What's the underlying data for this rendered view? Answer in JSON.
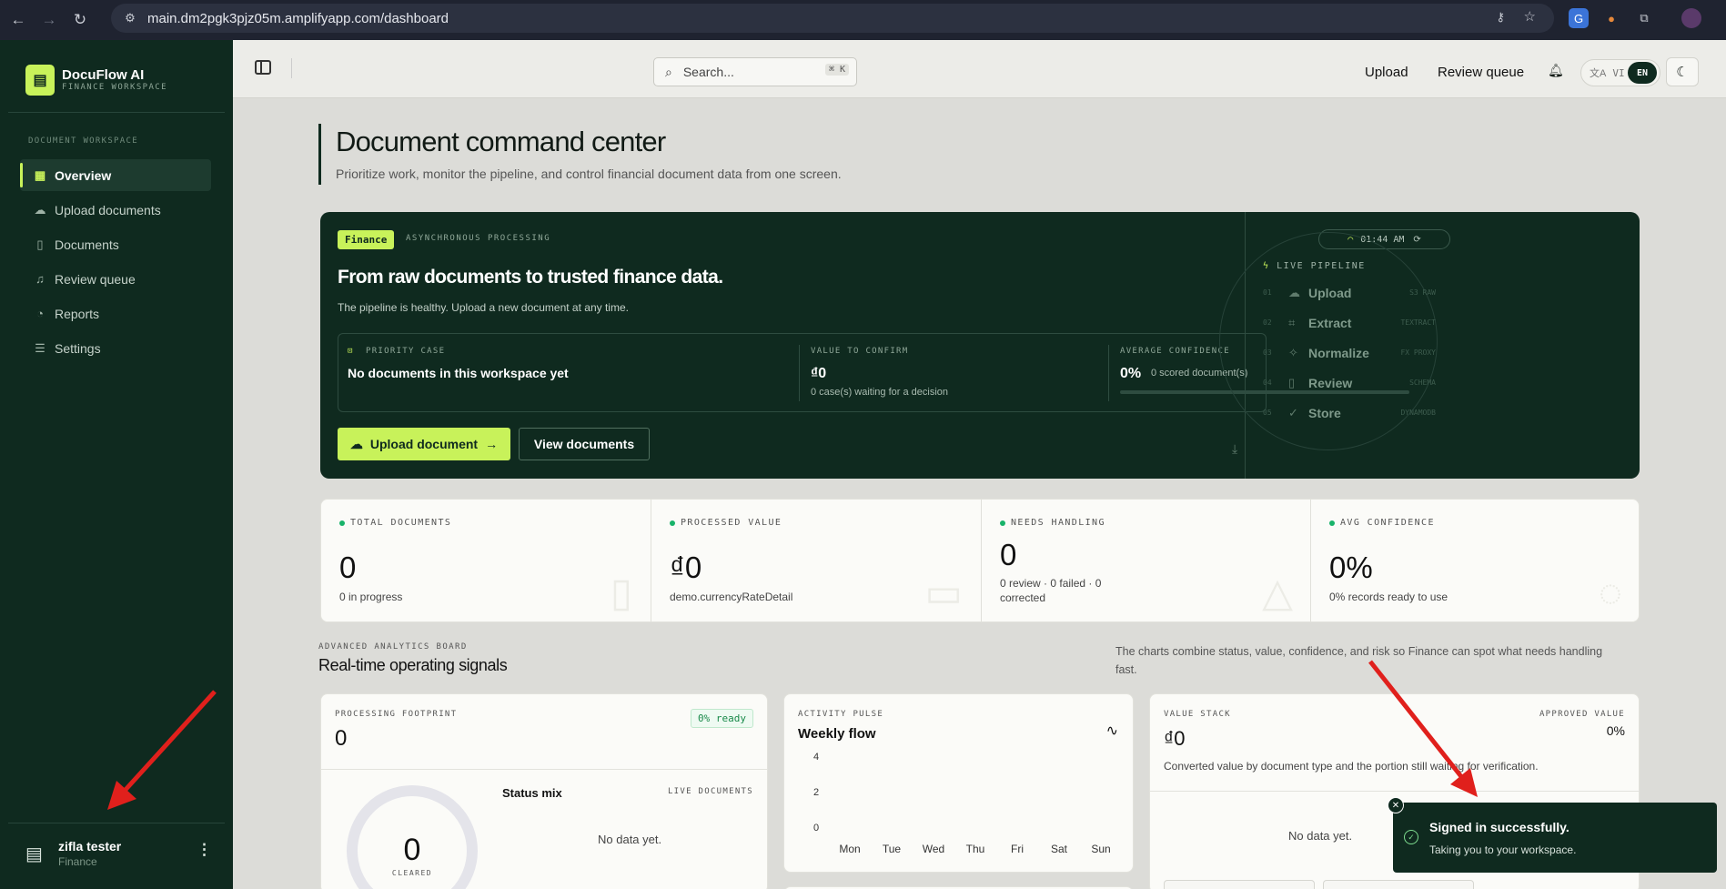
{
  "browser": {
    "url": "main.dm2pgk3pjz05m.amplifyapp.com/dashboard"
  },
  "sidebar": {
    "brand": "DocuFlow AI",
    "brand_sub": "FINANCE WORKSPACE",
    "section_label": "DOCUMENT WORKSPACE",
    "items": [
      {
        "label": "Overview",
        "icon": "grid-icon",
        "active": true
      },
      {
        "label": "Upload documents",
        "icon": "cloud-upload-icon"
      },
      {
        "label": "Documents",
        "icon": "file-icon"
      },
      {
        "label": "Review queue",
        "icon": "bell-icon"
      },
      {
        "label": "Reports",
        "icon": "chart-icon"
      },
      {
        "label": "Settings",
        "icon": "sliders-icon"
      }
    ],
    "user": {
      "name": "zifla tester",
      "role": "Finance"
    }
  },
  "topbar": {
    "search_placeholder": "Search...",
    "search_shortcut": "⌘ K",
    "upload_label": "Upload",
    "review_label": "Review queue",
    "lang_vi": "VI",
    "lang_en": "EN"
  },
  "header": {
    "title": "Document command center",
    "subtitle": "Prioritize work, monitor the pipeline, and control financial document data from one screen."
  },
  "hero": {
    "badge": "Finance",
    "mode": "ASYNCHRONOUS PROCESSING",
    "time": "01:44 AM",
    "title": "From raw documents to trusted finance data.",
    "subtitle": "The pipeline is healthy. Upload a new document at any time.",
    "priority_label": "PRIORITY CASE",
    "priority_value": "No documents in this workspace yet",
    "confirm_label": "VALUE TO CONFIRM",
    "confirm_value": "₫0",
    "confirm_sub": "0 case(s) waiting for a decision",
    "confidence_label": "AVERAGE CONFIDENCE",
    "confidence_value": "0%",
    "confidence_sub": "0 scored document(s)",
    "confidence_fraction": 0,
    "upload_btn": "Upload document",
    "view_btn": "View documents",
    "pipeline_label": "LIVE PIPELINE",
    "pipeline": [
      {
        "num": "01",
        "name": "Upload",
        "tag": "S3 RAW"
      },
      {
        "num": "02",
        "name": "Extract",
        "tag": "TEXTRACT"
      },
      {
        "num": "03",
        "name": "Normalize",
        "tag": "FX PROXY"
      },
      {
        "num": "04",
        "name": "Review",
        "tag": "SCHEMA"
      },
      {
        "num": "05",
        "name": "Store",
        "tag": "DYNAMODB"
      }
    ]
  },
  "stats": [
    {
      "label": "TOTAL DOCUMENTS",
      "value": "0",
      "sub": "0 in progress"
    },
    {
      "label": "PROCESSED VALUE",
      "value": "₫0",
      "sub": "demo.currencyRateDetail"
    },
    {
      "label": "NEEDS HANDLING",
      "value": "0",
      "sub": "0 review · 0 failed · 0 corrected"
    },
    {
      "label": "AVG CONFIDENCE",
      "value": "0%",
      "sub": "0% records ready to use"
    }
  ],
  "analytics": {
    "label": "ADVANCED ANALYTICS BOARD",
    "title": "Real-time operating signals",
    "desc": "The charts combine status, value, confidence, and risk so Finance can spot what needs handling fast."
  },
  "footprint": {
    "label": "PROCESSING FOOTPRINT",
    "value": "0",
    "ready": "0% ready",
    "donut_value": "0",
    "donut_label": "CLEARED",
    "mix_title": "Status mix",
    "live_label": "LIVE DOCUMENTS",
    "empty": "No data yet."
  },
  "pulse": {
    "label": "ACTIVITY PULSE",
    "title": "Weekly flow",
    "y_ticks": [
      "4",
      "2",
      "0"
    ],
    "days": [
      "Mon",
      "Tue",
      "Wed",
      "Thu",
      "Fri",
      "Sat",
      "Sun"
    ]
  },
  "value_stack": {
    "label": "VALUE STACK",
    "value": "₫0",
    "approved_label": "APPROVED VALUE",
    "approved_value": "0%",
    "desc": "Converted value by document type and the portion still waiting for verification.",
    "empty": "No data yet."
  },
  "toast": {
    "title": "Signed in successfully.",
    "message": "Taking you to your workspace."
  }
}
